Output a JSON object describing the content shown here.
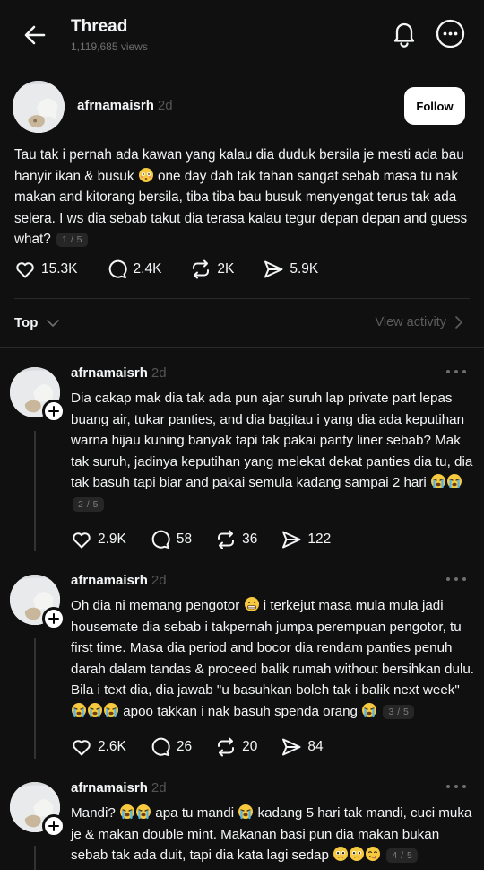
{
  "header": {
    "title": "Thread",
    "views": "1,119,685 views"
  },
  "main_post": {
    "username": "afrnamaisrh",
    "time": "2d",
    "follow_label": "Follow",
    "text_1": "Tau tak i pernah ada kawan yang kalau dia duduk bersila je mesti ada bau hanyir ikan & busuk ",
    "text_2": " one day dah tak tahan sangat sebab masa tu nak makan and kitorang bersila, tiba tiba bau busuk menyengat terus tak ada selera. I ws dia sebab takut dia terasa kalau tegur depan depan and guess what?",
    "page_badge": "1 / 5",
    "likes": "15.3K",
    "comments": "2.4K",
    "reposts": "2K",
    "shares": "5.9K"
  },
  "sort": {
    "label": "Top",
    "view_activity": "View activity"
  },
  "replies": [
    {
      "username": "afrnamaisrh",
      "time": "2d",
      "text_1": "Dia cakap mak dia tak ada pun ajar suruh lap private part lepas buang air, tukar panties, and dia bagitau i yang dia ada keputihan warna hijau kuning banyak tapi tak pakai panty liner sebab? Mak tak suruh, jadinya keputihan yang melekat dekat panties dia tu, dia tak basuh tapi biar and pakai semula kadang sampai 2 hari ",
      "page_badge": "2 / 5",
      "likes": "2.9K",
      "comments": "58",
      "reposts": "36",
      "shares": "122"
    },
    {
      "username": "afrnamaisrh",
      "time": "2d",
      "text_1": "Oh dia ni memang pengotor ",
      "text_2": " i terkejut masa mula mula jadi housemate dia sebab i takpernah jumpa perempuan pengotor, tu first time. Masa dia period and bocor dia rendam panties penuh darah dalam tandas & proceed balik rumah without bersihkan dulu. Bila i text dia, dia jawab \"u basuhkan boleh tak i balik next week\" ",
      "text_3": " apoo takkan i nak basuh spenda orang ",
      "page_badge": "3 / 5",
      "likes": "2.6K",
      "comments": "26",
      "reposts": "20",
      "shares": "84"
    },
    {
      "username": "afrnamaisrh",
      "time": "2d",
      "text_1": "Mandi? ",
      "text_2": " apa tu mandi ",
      "text_3": " kadang 5 hari tak mandi, cuci muka je & makan double mint. Makanan basi pun dia makan bukan sebab tak ada duit, tapi dia kata lagi sedap ",
      "page_badge": "4 / 5"
    }
  ],
  "colors": {
    "background": "#101010",
    "text": "#f3f5f7",
    "muted": "#6f6f6f",
    "divider": "#2a2a2a"
  }
}
